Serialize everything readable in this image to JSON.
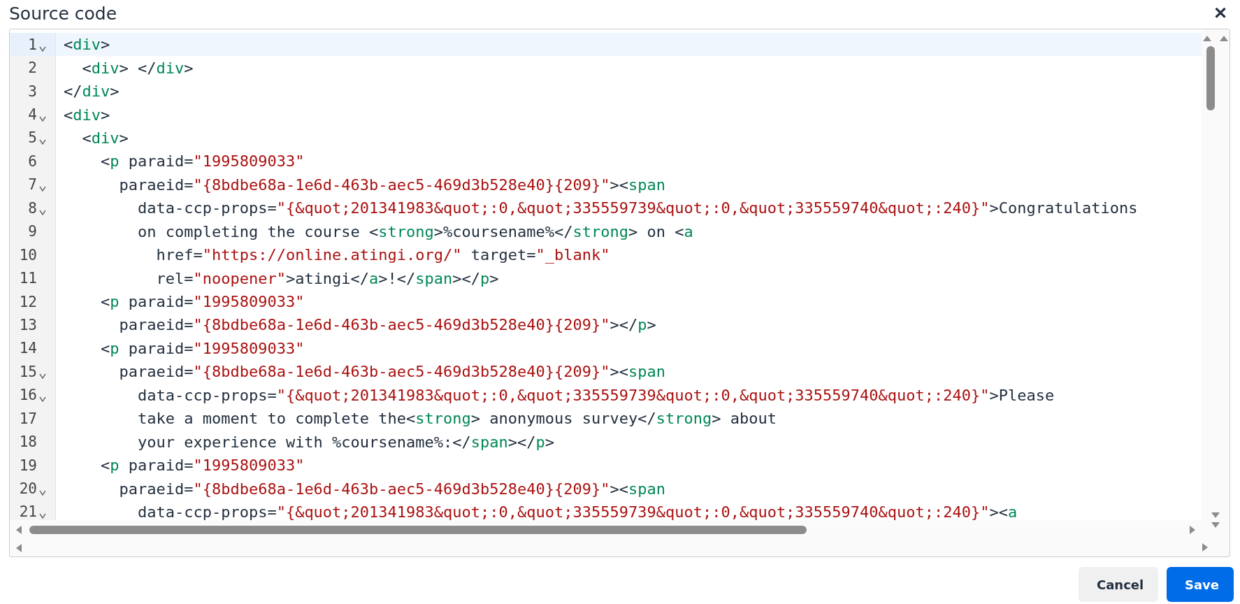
{
  "dialog": {
    "title": "Source code",
    "close_label": "✕"
  },
  "editor": {
    "lines": [
      {
        "number": "1",
        "foldable": true,
        "active": true,
        "tokens": [
          {
            "kind": "plain",
            "text": "<"
          },
          {
            "kind": "tag",
            "text": "div"
          },
          {
            "kind": "plain",
            "text": ">"
          }
        ]
      },
      {
        "number": "2",
        "foldable": false,
        "active": false,
        "tokens": [
          {
            "kind": "plain",
            "text": "  <"
          },
          {
            "kind": "tag",
            "text": "div"
          },
          {
            "kind": "plain",
            "text": "> </"
          },
          {
            "kind": "tag",
            "text": "div"
          },
          {
            "kind": "plain",
            "text": ">"
          }
        ]
      },
      {
        "number": "3",
        "foldable": false,
        "active": false,
        "tokens": [
          {
            "kind": "plain",
            "text": "</"
          },
          {
            "kind": "tag",
            "text": "div"
          },
          {
            "kind": "plain",
            "text": ">"
          }
        ]
      },
      {
        "number": "4",
        "foldable": true,
        "active": false,
        "tokens": [
          {
            "kind": "plain",
            "text": "<"
          },
          {
            "kind": "tag",
            "text": "div"
          },
          {
            "kind": "plain",
            "text": ">"
          }
        ]
      },
      {
        "number": "5",
        "foldable": true,
        "active": false,
        "tokens": [
          {
            "kind": "plain",
            "text": "  <"
          },
          {
            "kind": "tag",
            "text": "div"
          },
          {
            "kind": "plain",
            "text": ">"
          }
        ]
      },
      {
        "number": "6",
        "foldable": false,
        "active": false,
        "tokens": [
          {
            "kind": "plain",
            "text": "    <"
          },
          {
            "kind": "tag",
            "text": "p"
          },
          {
            "kind": "plain",
            "text": " paraid="
          },
          {
            "kind": "string",
            "text": "\"1995809033\""
          }
        ]
      },
      {
        "number": "7",
        "foldable": true,
        "active": false,
        "tokens": [
          {
            "kind": "plain",
            "text": "      paraeid="
          },
          {
            "kind": "string",
            "text": "\"{8bdbe68a-1e6d-463b-aec5-469d3b528e40}{209}\""
          },
          {
            "kind": "plain",
            "text": "><"
          },
          {
            "kind": "tag",
            "text": "span"
          }
        ]
      },
      {
        "number": "8",
        "foldable": true,
        "active": false,
        "tokens": [
          {
            "kind": "plain",
            "text": "        data-ccp-props="
          },
          {
            "kind": "string",
            "text": "\"{&quot;201341983&quot;:0,&quot;335559739&quot;:0,&quot;335559740&quot;:240}\""
          },
          {
            "kind": "plain",
            "text": ">Congratulations"
          }
        ]
      },
      {
        "number": "9",
        "foldable": false,
        "active": false,
        "tokens": [
          {
            "kind": "plain",
            "text": "        on completing the course <"
          },
          {
            "kind": "tag",
            "text": "strong"
          },
          {
            "kind": "plain",
            "text": ">%coursename%</"
          },
          {
            "kind": "tag",
            "text": "strong"
          },
          {
            "kind": "plain",
            "text": "> on <"
          },
          {
            "kind": "tag",
            "text": "a"
          }
        ]
      },
      {
        "number": "10",
        "foldable": false,
        "active": false,
        "tokens": [
          {
            "kind": "plain",
            "text": "          href="
          },
          {
            "kind": "string",
            "text": "\"https://online.atingi.org/\""
          },
          {
            "kind": "plain",
            "text": " target="
          },
          {
            "kind": "string",
            "text": "\"_blank\""
          }
        ]
      },
      {
        "number": "11",
        "foldable": false,
        "active": false,
        "tokens": [
          {
            "kind": "plain",
            "text": "          rel="
          },
          {
            "kind": "string",
            "text": "\"noopener\""
          },
          {
            "kind": "plain",
            "text": ">atingi</"
          },
          {
            "kind": "tag",
            "text": "a"
          },
          {
            "kind": "plain",
            "text": ">!</"
          },
          {
            "kind": "tag",
            "text": "span"
          },
          {
            "kind": "plain",
            "text": "></"
          },
          {
            "kind": "tag",
            "text": "p"
          },
          {
            "kind": "plain",
            "text": ">"
          }
        ]
      },
      {
        "number": "12",
        "foldable": false,
        "active": false,
        "tokens": [
          {
            "kind": "plain",
            "text": "    <"
          },
          {
            "kind": "tag",
            "text": "p"
          },
          {
            "kind": "plain",
            "text": " paraid="
          },
          {
            "kind": "string",
            "text": "\"1995809033\""
          }
        ]
      },
      {
        "number": "13",
        "foldable": false,
        "active": false,
        "tokens": [
          {
            "kind": "plain",
            "text": "      paraeid="
          },
          {
            "kind": "string",
            "text": "\"{8bdbe68a-1e6d-463b-aec5-469d3b528e40}{209}\""
          },
          {
            "kind": "plain",
            "text": "></"
          },
          {
            "kind": "tag",
            "text": "p"
          },
          {
            "kind": "plain",
            "text": ">"
          }
        ]
      },
      {
        "number": "14",
        "foldable": false,
        "active": false,
        "tokens": [
          {
            "kind": "plain",
            "text": "    <"
          },
          {
            "kind": "tag",
            "text": "p"
          },
          {
            "kind": "plain",
            "text": " paraid="
          },
          {
            "kind": "string",
            "text": "\"1995809033\""
          }
        ]
      },
      {
        "number": "15",
        "foldable": true,
        "active": false,
        "tokens": [
          {
            "kind": "plain",
            "text": "      paraeid="
          },
          {
            "kind": "string",
            "text": "\"{8bdbe68a-1e6d-463b-aec5-469d3b528e40}{209}\""
          },
          {
            "kind": "plain",
            "text": "><"
          },
          {
            "kind": "tag",
            "text": "span"
          }
        ]
      },
      {
        "number": "16",
        "foldable": true,
        "active": false,
        "tokens": [
          {
            "kind": "plain",
            "text": "        data-ccp-props="
          },
          {
            "kind": "string",
            "text": "\"{&quot;201341983&quot;:0,&quot;335559739&quot;:0,&quot;335559740&quot;:240}\""
          },
          {
            "kind": "plain",
            "text": ">Please"
          }
        ]
      },
      {
        "number": "17",
        "foldable": false,
        "active": false,
        "tokens": [
          {
            "kind": "plain",
            "text": "        take a moment to complete the<"
          },
          {
            "kind": "tag",
            "text": "strong"
          },
          {
            "kind": "plain",
            "text": "> anonymous survey</"
          },
          {
            "kind": "tag",
            "text": "strong"
          },
          {
            "kind": "plain",
            "text": "> about"
          }
        ]
      },
      {
        "number": "18",
        "foldable": false,
        "active": false,
        "tokens": [
          {
            "kind": "plain",
            "text": "        your experience with %coursename%:</"
          },
          {
            "kind": "tag",
            "text": "span"
          },
          {
            "kind": "plain",
            "text": "></"
          },
          {
            "kind": "tag",
            "text": "p"
          },
          {
            "kind": "plain",
            "text": ">"
          }
        ]
      },
      {
        "number": "19",
        "foldable": false,
        "active": false,
        "tokens": [
          {
            "kind": "plain",
            "text": "    <"
          },
          {
            "kind": "tag",
            "text": "p"
          },
          {
            "kind": "plain",
            "text": " paraid="
          },
          {
            "kind": "string",
            "text": "\"1995809033\""
          }
        ]
      },
      {
        "number": "20",
        "foldable": true,
        "active": false,
        "tokens": [
          {
            "kind": "plain",
            "text": "      paraeid="
          },
          {
            "kind": "string",
            "text": "\"{8bdbe68a-1e6d-463b-aec5-469d3b528e40}{209}\""
          },
          {
            "kind": "plain",
            "text": "><"
          },
          {
            "kind": "tag",
            "text": "span"
          }
        ]
      },
      {
        "number": "21",
        "foldable": true,
        "active": false,
        "tokens": [
          {
            "kind": "plain",
            "text": "        data-ccp-props="
          },
          {
            "kind": "string",
            "text": "\"{&quot;201341983&quot;:0,&quot;335559739&quot;:0,&quot;335559740&quot;:240}\""
          },
          {
            "kind": "plain",
            "text": "><"
          },
          {
            "kind": "tag",
            "text": "a"
          }
        ]
      }
    ]
  },
  "buttons": [
    {
      "label": "Cancel",
      "kind": "secondary"
    },
    {
      "label": "Save",
      "kind": "primary"
    }
  ]
}
